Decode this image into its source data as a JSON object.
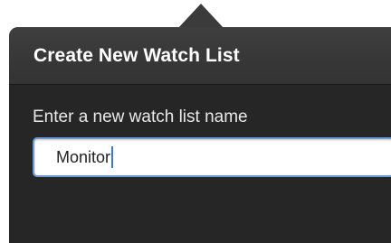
{
  "popover": {
    "title": "Create New Watch List",
    "field_label": "Enter a new watch list name",
    "input_value": "Monitor"
  },
  "colors": {
    "panel_background": "#262626",
    "header_background": "#383838",
    "input_focus_border": "#6a9cd6",
    "caret": "#3a78d6"
  }
}
